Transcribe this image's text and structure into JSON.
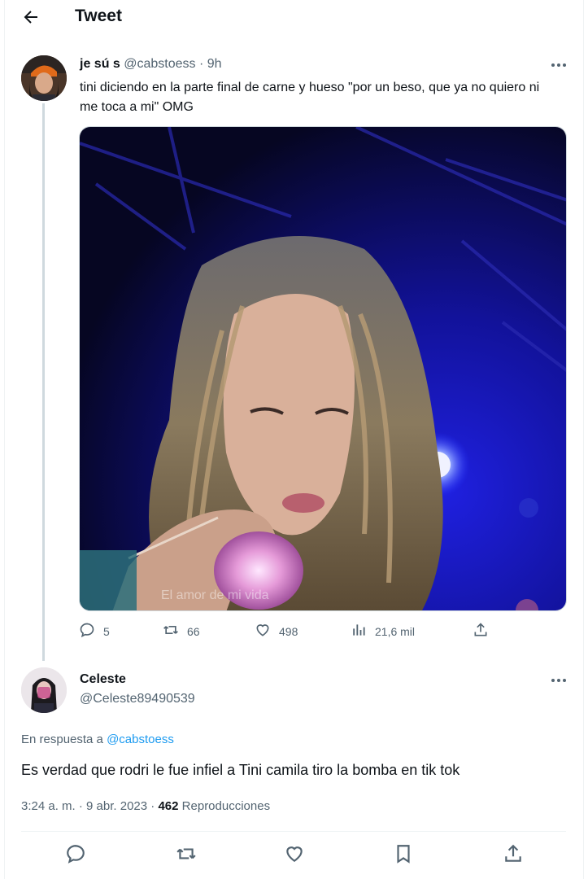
{
  "header": {
    "title": "Tweet"
  },
  "tweet": {
    "name": "je sú s",
    "handle": "@cabstoess",
    "separator": "·",
    "time": "9h",
    "text": "tini diciendo en la parte final de carne y hueso \"por un beso, que ya no quiero ni me toca a mi\" OMG",
    "media_watermark": "El amor de mi vida",
    "stats": {
      "replies": "5",
      "retweets": "66",
      "likes": "498",
      "views": "21,6 mil"
    }
  },
  "reply": {
    "name": "Celeste",
    "handle": "@Celeste89490539",
    "reply_prefix": "En respuesta a",
    "reply_to": "@cabstoess",
    "text": "Es verdad que rodri le fue infiel a Tini camila tiro la bomba en tik tok",
    "time": "3:24 a. m.",
    "date": "9 abr. 2023",
    "views_count": "462",
    "views_label": "Reproducciones"
  },
  "colors": {
    "accent": "#1d9bf0",
    "muted": "#536471",
    "text": "#0f1419",
    "stage_blue": "#1a1ad8"
  }
}
